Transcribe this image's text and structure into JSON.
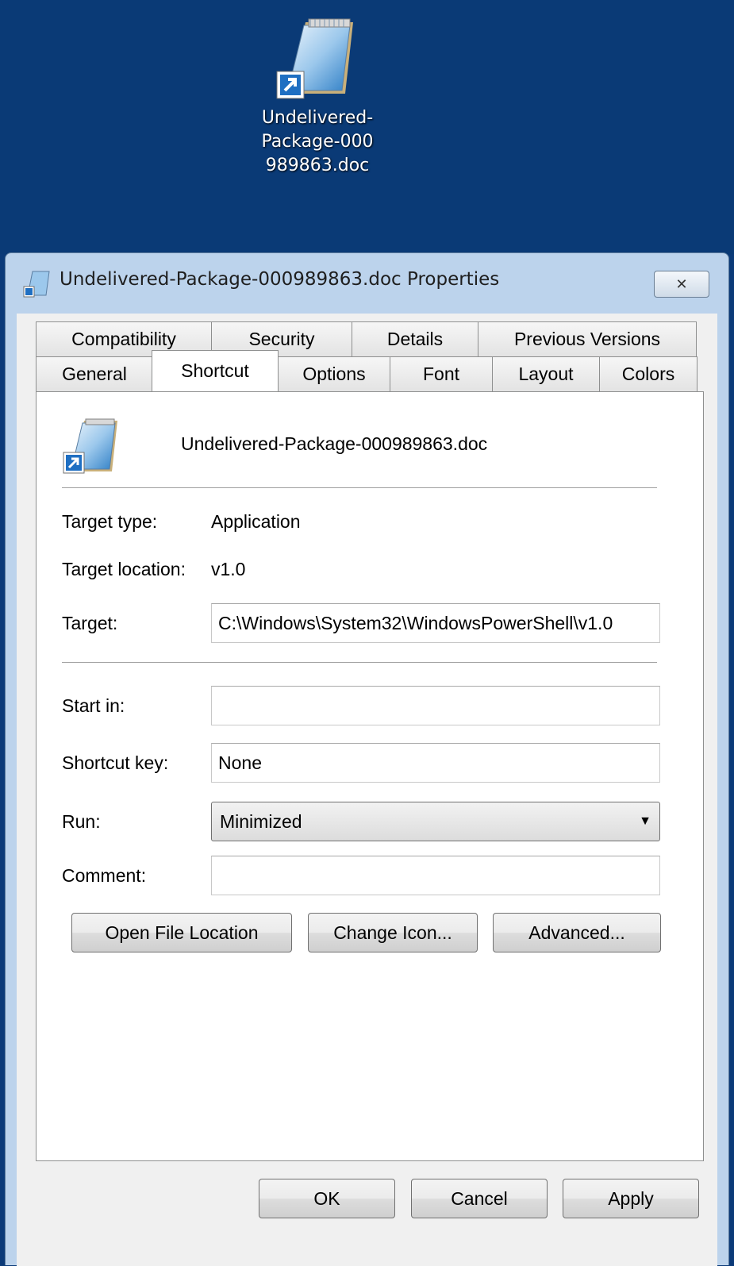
{
  "desktop": {
    "icon_label_lines": [
      "Undelivered-",
      "Package-000",
      "989863.doc"
    ],
    "icon": "notepad-shortcut-icon"
  },
  "window": {
    "title": "Undelivered-Package-000989863.doc Properties",
    "close_glyph": "✕",
    "title_icon": "notepad-shortcut-icon"
  },
  "tabs": {
    "row1": [
      "Compatibility",
      "Security",
      "Details",
      "Previous Versions"
    ],
    "row2": [
      "General",
      "Shortcut",
      "Options",
      "Font",
      "Layout",
      "Colors"
    ],
    "active": "Shortcut"
  },
  "shortcut": {
    "name": "Undelivered-Package-000989863.doc",
    "target_type_label": "Target type:",
    "target_type_value": "Application",
    "target_location_label": "Target location:",
    "target_location_value": "v1.0",
    "target_label": "Target:",
    "target_value": "C:\\Windows\\System32\\WindowsPowerShell\\v1.0",
    "start_in_label": "Start in:",
    "start_in_value": "",
    "shortcut_key_label": "Shortcut key:",
    "shortcut_key_value": "None",
    "run_label": "Run:",
    "run_value": "Minimized",
    "comment_label": "Comment:",
    "comment_value": "",
    "open_file_location": "Open File Location",
    "change_icon": "Change Icon...",
    "advanced": "Advanced..."
  },
  "footer": {
    "ok": "OK",
    "cancel": "Cancel",
    "apply": "Apply"
  }
}
